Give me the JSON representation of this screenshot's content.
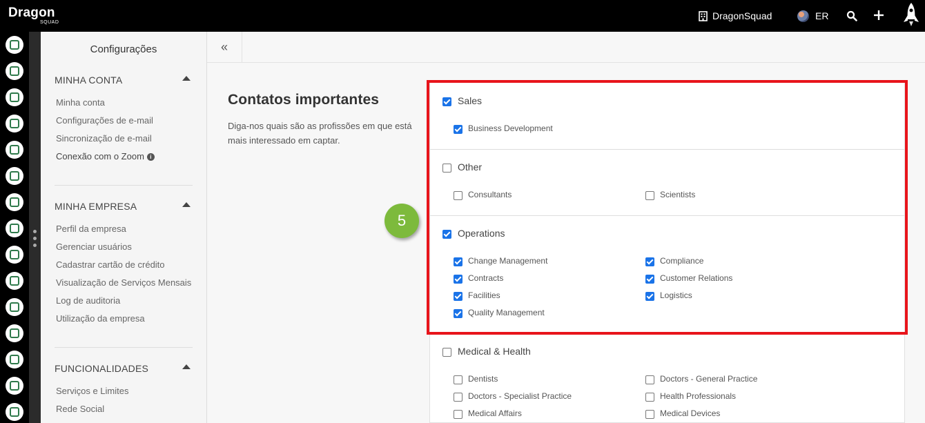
{
  "topbar": {
    "logo": "Dragon",
    "logo_sub": "SQUAD",
    "company": "DragonSquad",
    "user_initials": "ER"
  },
  "rail": {
    "icons": [
      "contacts-icon",
      "inbox-icon",
      "clipboard-icon",
      "map-icon",
      "pipeline-icon",
      "list-icon",
      "megaphone-icon",
      "chat-icon",
      "thumbs-up-icon",
      "tv-icon",
      "gallery-icon",
      "calendar-icon",
      "handshake-icon",
      "analytics-icon",
      "support-icon"
    ]
  },
  "settings": {
    "title": "Configurações",
    "sections": [
      {
        "heading": "MINHA CONTA",
        "links": [
          "Minha conta",
          "Configurações de e-mail",
          "Sincronização de e-mail",
          "Conexão com o Zoom"
        ]
      },
      {
        "heading": "MINHA EMPRESA",
        "links": [
          "Perfil da empresa",
          "Gerenciar usuários",
          "Cadastrar cartão de crédito",
          "Visualização de Serviços Mensais",
          "Log de auditoria",
          "Utilização da empresa"
        ]
      },
      {
        "heading": "FUNCIONALIDADES",
        "links": [
          "Serviços e Limites",
          "Rede Social"
        ]
      }
    ]
  },
  "content": {
    "collapse_label": "«",
    "title": "Contatos importantes",
    "description": "Diga-nos quais são as profissões em que está mais interessado em captar.",
    "step_badge": "5",
    "groups": [
      {
        "name": "Sales",
        "checked": true,
        "items": [
          {
            "label": "Business Development",
            "checked": true
          }
        ]
      },
      {
        "name": "Other",
        "checked": false,
        "items": [
          {
            "label": "Consultants",
            "checked": false
          },
          {
            "label": "Scientists",
            "checked": false
          }
        ]
      },
      {
        "name": "Operations",
        "checked": true,
        "items": [
          {
            "label": "Change Management",
            "checked": true
          },
          {
            "label": "Compliance",
            "checked": true
          },
          {
            "label": "Contracts",
            "checked": true
          },
          {
            "label": "Customer Relations",
            "checked": true
          },
          {
            "label": "Facilities",
            "checked": true
          },
          {
            "label": "Logistics",
            "checked": true
          },
          {
            "label": "Quality Management",
            "checked": true
          }
        ]
      },
      {
        "name": "Medical & Health",
        "checked": false,
        "items": [
          {
            "label": "Dentists",
            "checked": false
          },
          {
            "label": "Doctors - General Practice",
            "checked": false
          },
          {
            "label": "Doctors - Specialist Practice",
            "checked": false
          },
          {
            "label": "Health Professionals",
            "checked": false
          },
          {
            "label": "Medical Affairs",
            "checked": false
          },
          {
            "label": "Medical Devices",
            "checked": false
          }
        ]
      }
    ]
  },
  "colors": {
    "accent": "#1a73e8",
    "highlight": "#e8141b",
    "badge": "#7dba3c",
    "rail": "#000000"
  }
}
